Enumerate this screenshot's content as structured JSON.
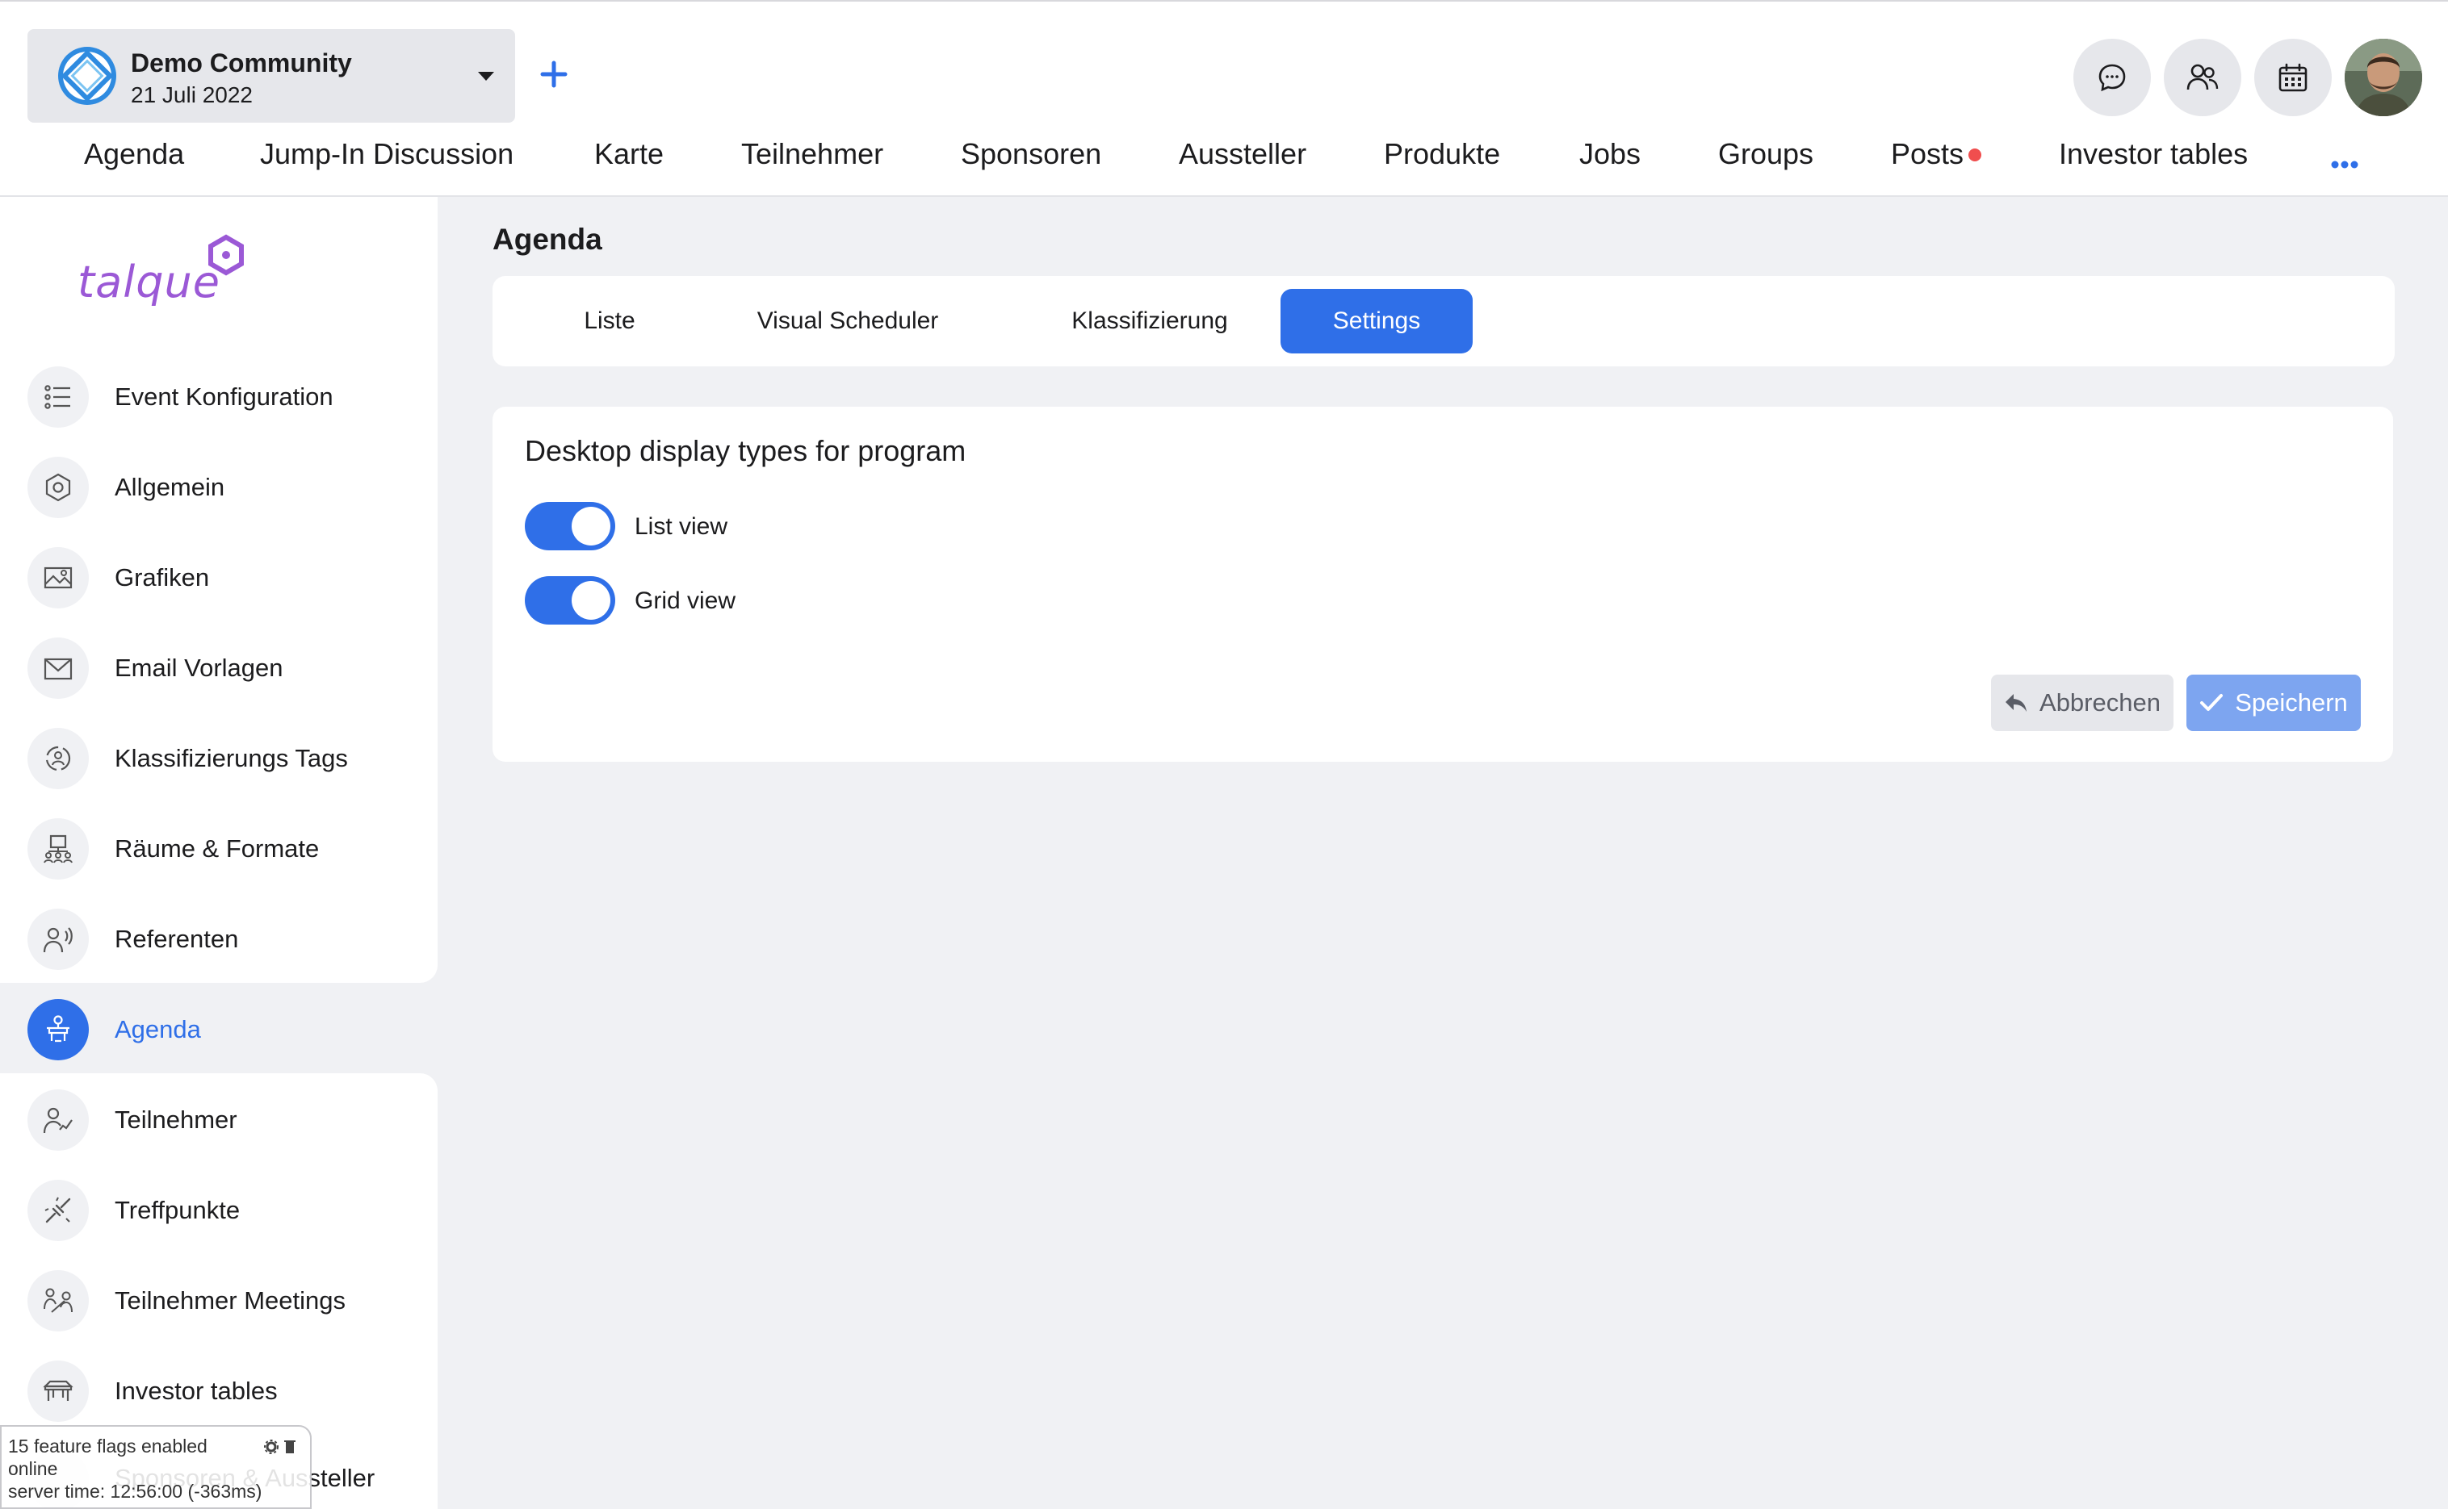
{
  "community": {
    "name": "Demo Community",
    "date": "21 Juli 2022"
  },
  "header_icons": [
    "chat-icon",
    "people-icon",
    "calendar-icon"
  ],
  "nav": {
    "items": [
      "Agenda",
      "Jump-In Discussion",
      "Karte",
      "Teilnehmer",
      "Sponsoren",
      "Aussteller",
      "Produkte",
      "Jobs",
      "Groups",
      "Posts",
      "Investor tables"
    ],
    "badge_item": "Posts"
  },
  "brand": {
    "logo_text": "talque",
    "logo_color": "#9b59d6"
  },
  "sidebar": {
    "items": [
      {
        "label": "Event Konfiguration",
        "icon": "list-icon"
      },
      {
        "label": "Allgemein",
        "icon": "hexagon-settings-icon"
      },
      {
        "label": "Grafiken",
        "icon": "image-icon"
      },
      {
        "label": "Email Vorlagen",
        "icon": "mail-icon"
      },
      {
        "label": "Klassifizierungs Tags",
        "icon": "tags-icon"
      },
      {
        "label": "Räume & Formate",
        "icon": "rooms-icon"
      },
      {
        "label": "Referenten",
        "icon": "speaker-icon"
      },
      {
        "label": "Agenda",
        "icon": "agenda-icon",
        "active": true
      },
      {
        "label": "Teilnehmer",
        "icon": "participant-icon"
      },
      {
        "label": "Treffpunkte",
        "icon": "meeting-point-icon"
      },
      {
        "label": "Teilnehmer Meetings",
        "icon": "meetings-icon"
      },
      {
        "label": "Investor tables",
        "icon": "table-icon"
      },
      {
        "label": "Sponsoren & Aussteller",
        "icon": "sponsor-icon"
      }
    ]
  },
  "main": {
    "title": "Agenda",
    "tabs": [
      {
        "label": "Liste"
      },
      {
        "label": "Visual Scheduler"
      },
      {
        "label": "Klassifizierung"
      },
      {
        "label": "Settings",
        "active": true
      }
    ],
    "card": {
      "title": "Desktop display types for program",
      "toggles": [
        {
          "label": "List view",
          "on": true
        },
        {
          "label": "Grid view",
          "on": true
        }
      ],
      "cancel_label": "Abbrechen",
      "save_label": "Speichern"
    }
  },
  "debug": {
    "flags": "15 feature flags enabled",
    "status": "online",
    "server_time": "server time: 12:56:00 (-363ms)"
  },
  "colors": {
    "accent": "#2f6fe8",
    "accent_light": "#7da5f0",
    "notification": "#f04e4e",
    "background": "#f0f1f4"
  }
}
